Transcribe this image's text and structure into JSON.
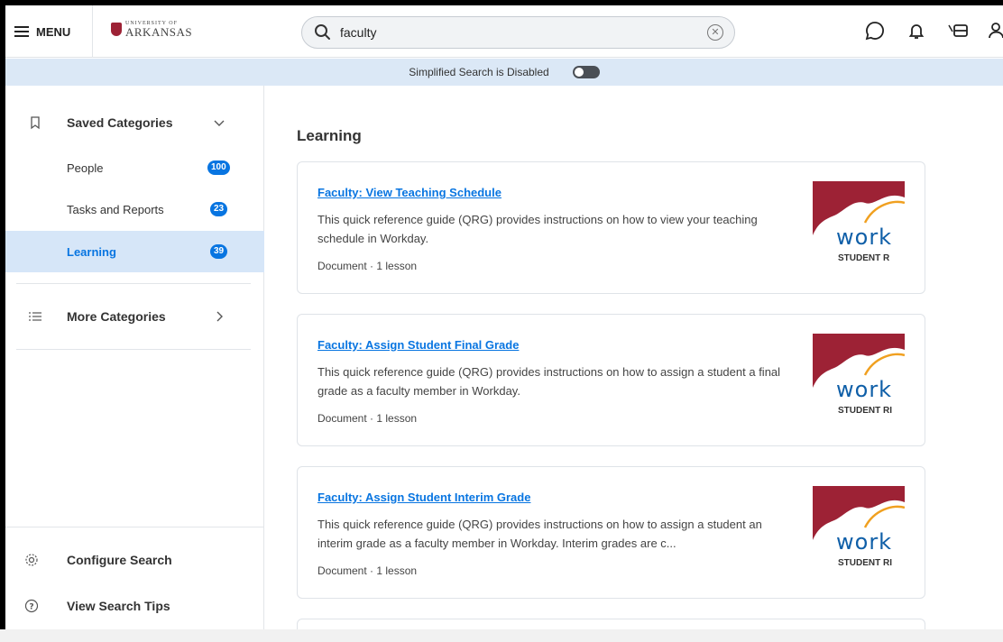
{
  "header": {
    "menu_label": "MENU",
    "logo_small": "UNIVERSITY OF",
    "logo_big": "ARKANSAS",
    "search_value": "faculty",
    "icons": [
      "chat-icon",
      "bell-icon",
      "inbox-icon",
      "user-icon"
    ]
  },
  "banner": {
    "text": "Simplified Search is Disabled",
    "toggle_on": false
  },
  "sidebar": {
    "saved_categories": "Saved Categories",
    "items": [
      {
        "label": "People",
        "count": "100"
      },
      {
        "label": "Tasks and Reports",
        "count": "23"
      },
      {
        "label": "Learning",
        "count": "39"
      }
    ],
    "more_categories": "More Categories",
    "configure_search": "Configure Search",
    "view_search_tips": "View Search Tips"
  },
  "main": {
    "section_title": "Learning",
    "results": [
      {
        "title": "Faculty: View Teaching Schedule",
        "description": "This quick reference guide (QRG) provides instructions on how to view your teaching schedule in Workday.",
        "meta": "Document  ·  1 lesson",
        "thumb_word": "work",
        "thumb_caption": "STUDENT R"
      },
      {
        "title": "Faculty: Assign Student Final Grade",
        "description": "This quick reference guide (QRG) provides instructions on how to assign a student a final grade as a faculty member in Workday.",
        "meta": "Document  ·  1 lesson",
        "thumb_word": "work",
        "thumb_caption": "STUDENT RI"
      },
      {
        "title": "Faculty: Assign Student Interim Grade",
        "description": "This quick reference guide (QRG) provides instructions on how to assign a student an interim grade as a faculty member in Workday. Interim grades are c...",
        "meta": "Document  ·  1 lesson",
        "thumb_word": "work",
        "thumb_caption": "STUDENT RI"
      }
    ]
  },
  "colors": {
    "accent": "#0875e1",
    "banner_bg": "#dbe8f6",
    "active_bg": "#d6e6f8",
    "brand_red": "#9d2235",
    "thumb_orange": "#f0a020"
  }
}
